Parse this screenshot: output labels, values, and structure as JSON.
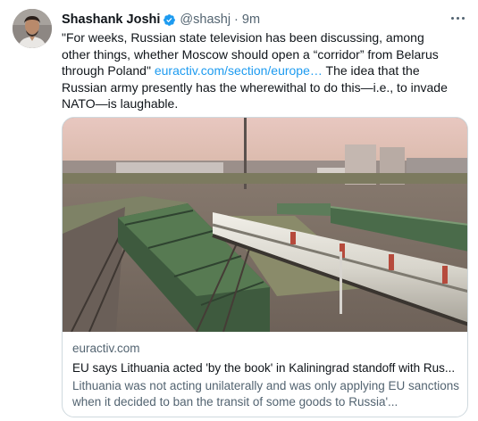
{
  "tweet": {
    "author_name": "Shashank Joshi",
    "handle": "@shashj",
    "separator": "·",
    "time": "9m",
    "text_before_link": "\"For weeks, Russian state television has been discussing, among other things, whether Moscow should open a “corridor” from Belarus through Poland\" ",
    "link_text": "euractiv.com/section/europe…",
    "text_after_link": " The idea that the Russian army presently has the wherewithal to do this—i.e., to invade NATO—is laughable.",
    "icons": {
      "avatar": "avatar-photo",
      "verified": "verified-badge-icon",
      "more": "more-options-icon"
    },
    "colors": {
      "link": "#1d9bf0",
      "secondary_text": "#536471",
      "verified_badge": "#1d9bf0"
    }
  },
  "card": {
    "domain": "euractiv.com",
    "title": "EU says Lithuania acted 'by the book' in Kaliningrad standoff with Rus...",
    "description": "Lithuania was not acting unilaterally and was only applying EU sanctions when it decided to ban the transit of some goods to Russia'..."
  }
}
